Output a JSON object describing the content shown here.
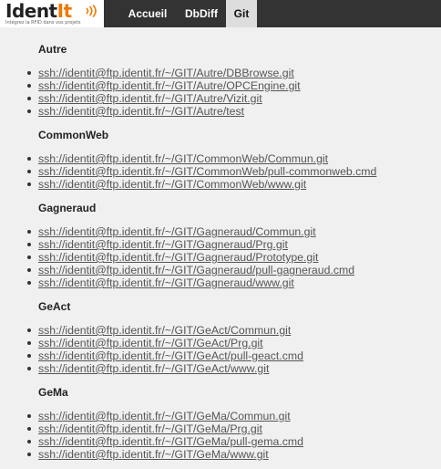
{
  "logo": {
    "text_ident": "Ident",
    "text_it": "It",
    "tagline": "Intégrez la RFID dans vos projets"
  },
  "nav": {
    "items": [
      {
        "label": "Accueil",
        "active": false
      },
      {
        "label": "DbDiff",
        "active": false
      },
      {
        "label": "Git",
        "active": true
      }
    ]
  },
  "groups": [
    {
      "title": "Autre",
      "links": [
        "ssh://identit@ftp.identit.fr/~/GIT/Autre/DBBrowse.git",
        "ssh://identit@ftp.identit.fr/~/GIT/Autre/OPCEngine.git",
        "ssh://identit@ftp.identit.fr/~/GIT/Autre/Vizit.git",
        "ssh://identit@ftp.identit.fr/~/GIT/Autre/test"
      ]
    },
    {
      "title": "CommonWeb",
      "links": [
        "ssh://identit@ftp.identit.fr/~/GIT/CommonWeb/Commun.git",
        "ssh://identit@ftp.identit.fr/~/GIT/CommonWeb/pull-commonweb.cmd",
        "ssh://identit@ftp.identit.fr/~/GIT/CommonWeb/www.git"
      ]
    },
    {
      "title": "Gagneraud",
      "links": [
        "ssh://identit@ftp.identit.fr/~/GIT/Gagneraud/Commun.git",
        "ssh://identit@ftp.identit.fr/~/GIT/Gagneraud/Prg.git",
        "ssh://identit@ftp.identit.fr/~/GIT/Gagneraud/Prototype.git",
        "ssh://identit@ftp.identit.fr/~/GIT/Gagneraud/pull-gagneraud.cmd",
        "ssh://identit@ftp.identit.fr/~/GIT/Gagneraud/www.git"
      ]
    },
    {
      "title": "GeAct",
      "links": [
        "ssh://identit@ftp.identit.fr/~/GIT/GeAct/Commun.git",
        "ssh://identit@ftp.identit.fr/~/GIT/GeAct/Prg.git",
        "ssh://identit@ftp.identit.fr/~/GIT/GeAct/pull-geact.cmd",
        "ssh://identit@ftp.identit.fr/~/GIT/GeAct/www.git"
      ]
    },
    {
      "title": "GeMa",
      "links": [
        "ssh://identit@ftp.identit.fr/~/GIT/GeMa/Commun.git",
        "ssh://identit@ftp.identit.fr/~/GIT/GeMa/Prg.git",
        "ssh://identit@ftp.identit.fr/~/GIT/GeMa/pull-gema.cmd",
        "ssh://identit@ftp.identit.fr/~/GIT/GeMa/www.git"
      ]
    }
  ]
}
